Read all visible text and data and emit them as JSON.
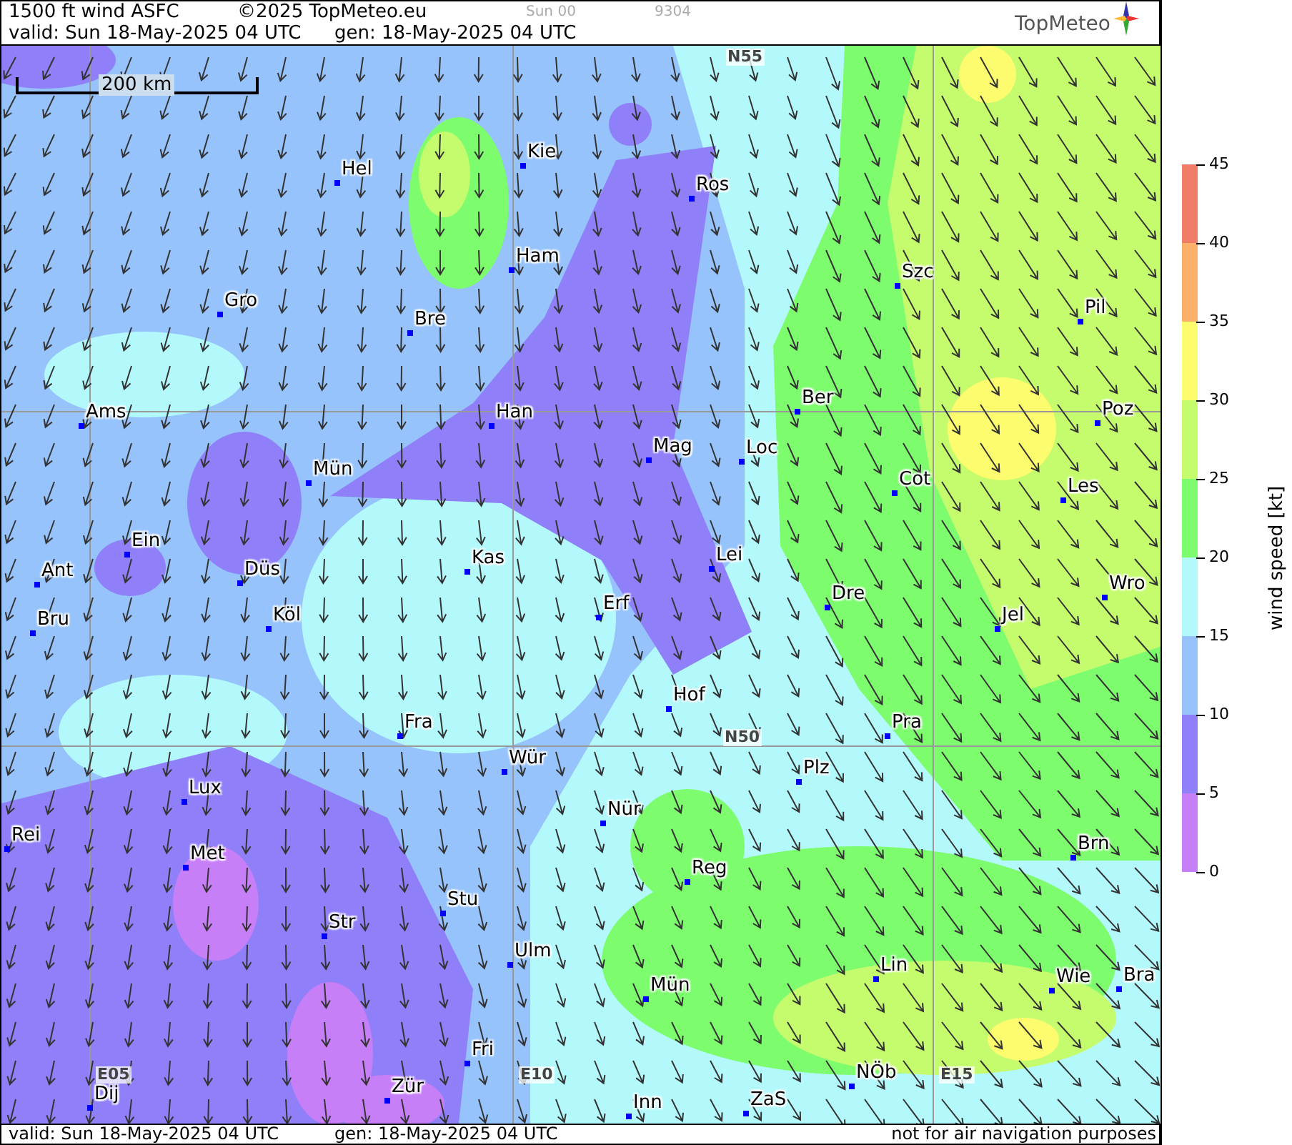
{
  "header": {
    "title": "1500 ft wind ASFC",
    "copyright": "©2025 TopMeteo.eu",
    "run": "Sun 00",
    "code": "9304",
    "valid": "valid:  Sun  18-May-2025  04 UTC",
    "generated": "gen: 18-May-2025 04 UTC",
    "logo": "TopMeteo"
  },
  "map": {
    "scale": "200 km",
    "grid_labels": [
      "N55",
      "N50",
      "E05",
      "E10",
      "E15"
    ],
    "cities": [
      "Hel",
      "Kie",
      "Ros",
      "Gro",
      "Ham",
      "Bre",
      "Szc",
      "Pil",
      "Ams",
      "Han",
      "Ber",
      "Poz",
      "Mag",
      "Loc",
      "Mün",
      "Cot",
      "Les",
      "Ein",
      "Ant",
      "Düs",
      "Kas",
      "Lei",
      "Wro",
      "Dre",
      "Erf",
      "Bru",
      "Köl",
      "Jel",
      "Hof",
      "Fra",
      "Pra",
      "Wür",
      "Plz",
      "Lux",
      "Nür",
      "Rei",
      "Brn",
      "Met",
      "Reg",
      "Stu",
      "Str",
      "Ulm",
      "Lin",
      "Wie",
      "Bra",
      "Mün",
      "Fri",
      "NÖb",
      "Dij",
      "Zür",
      "Inn",
      "ZaS"
    ]
  },
  "legend": {
    "title": "wind speed [kt]",
    "ticks": [
      "45",
      "40",
      "35",
      "30",
      "25",
      "20",
      "15",
      "10",
      "5",
      "0"
    ],
    "bands": [
      {
        "color": "#f07d68"
      },
      {
        "color": "#fdb06a"
      },
      {
        "color": "#fdfc6e"
      },
      {
        "color": "#c5fc6e"
      },
      {
        "color": "#7dfc6e"
      },
      {
        "color": "#b3f9fc"
      },
      {
        "color": "#96c3fb"
      },
      {
        "color": "#8f7ff8"
      },
      {
        "color": "#c77ff8"
      }
    ]
  },
  "footer": {
    "valid": "valid:  Sun  18-May-2025  04 UTC",
    "generated": "gen: 18-May-2025 04 UTC",
    "disclaimer": "not for air navigation purposes"
  }
}
